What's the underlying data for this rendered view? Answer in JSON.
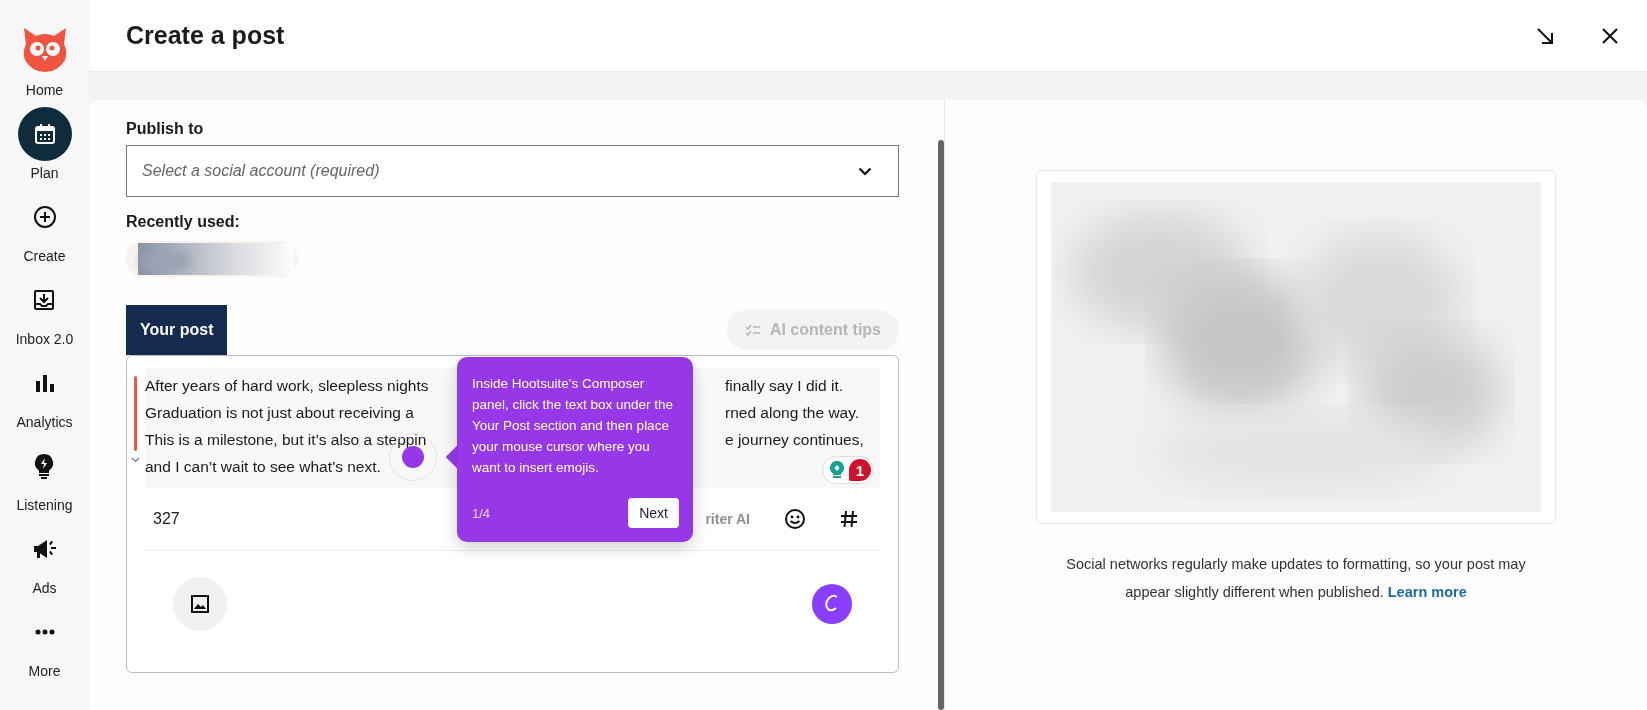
{
  "header": {
    "title": "Create a post"
  },
  "sidebar": {
    "items": [
      {
        "label": "Home",
        "selected": false
      },
      {
        "label": "Plan",
        "selected": true
      },
      {
        "label": "Create",
        "selected": false
      },
      {
        "label": "Inbox 2.0",
        "selected": false
      },
      {
        "label": "Analytics",
        "selected": false
      },
      {
        "label": "Listening",
        "selected": false
      },
      {
        "label": "Ads",
        "selected": false
      },
      {
        "label": "More",
        "selected": false
      }
    ]
  },
  "composer": {
    "publish_label": "Publish to",
    "account_select": {
      "placeholder": "Select a social account (required)"
    },
    "recent_label": "Recently used:",
    "tabs": [
      {
        "label": "Your post",
        "selected": true
      }
    ],
    "ai_tips": {
      "label": "AI content tips",
      "disabled": true
    },
    "post": {
      "lines": [
        {
          "left": "After years of hard work, sleepless nights",
          "right": "finally say I did it."
        },
        {
          "left": "Graduation is not just about receiving a",
          "right": "rned along the way."
        },
        {
          "left": "This is a milestone, but it’s also a steppin",
          "right": "e journey continues,"
        },
        {
          "left": "and I can’t wait to see what’s next."
        }
      ],
      "suggestion_count": "1",
      "char_count": "327",
      "writer_ai": "riter AI"
    }
  },
  "tour": {
    "text": "Inside Hootsuite's Composer panel, click the text box under the Your Post section and then place your mouse cursor where you want to insert emojis.",
    "step": "1/4",
    "next": "Next"
  },
  "preview": {
    "note": "Social networks regularly make updates to formatting, so your post may appear slightly different when published.",
    "link": "Learn more"
  }
}
